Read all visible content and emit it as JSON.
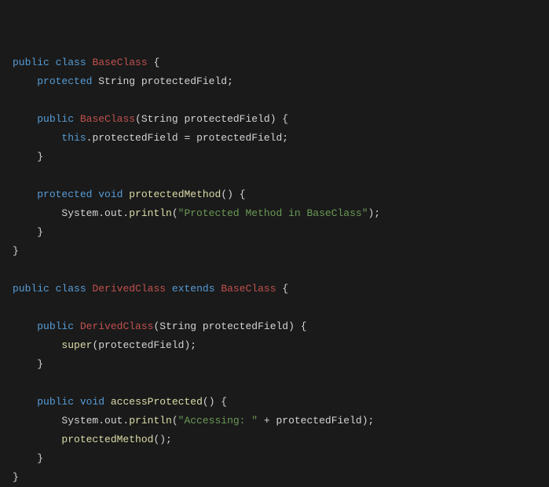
{
  "tokens": [
    {
      "cls": "kw",
      "t": "public"
    },
    {
      "cls": "pln",
      "t": " "
    },
    {
      "cls": "kw",
      "t": "class"
    },
    {
      "cls": "pln",
      "t": " "
    },
    {
      "cls": "cls",
      "t": "BaseClass"
    },
    {
      "cls": "pln",
      "t": " {\n"
    },
    {
      "cls": "pln",
      "t": "    "
    },
    {
      "cls": "kw",
      "t": "protected"
    },
    {
      "cls": "pln",
      "t": " String protectedField;\n"
    },
    {
      "cls": "pln",
      "t": "\n"
    },
    {
      "cls": "pln",
      "t": "    "
    },
    {
      "cls": "kw",
      "t": "public"
    },
    {
      "cls": "pln",
      "t": " "
    },
    {
      "cls": "cls",
      "t": "BaseClass"
    },
    {
      "cls": "pln",
      "t": "(String protectedField) {\n"
    },
    {
      "cls": "pln",
      "t": "        "
    },
    {
      "cls": "self",
      "t": "this"
    },
    {
      "cls": "pln",
      "t": ".protectedField = protectedField;\n"
    },
    {
      "cls": "pln",
      "t": "    }\n"
    },
    {
      "cls": "pln",
      "t": "\n"
    },
    {
      "cls": "pln",
      "t": "    "
    },
    {
      "cls": "kw",
      "t": "protected"
    },
    {
      "cls": "pln",
      "t": " "
    },
    {
      "cls": "kw",
      "t": "void"
    },
    {
      "cls": "pln",
      "t": " "
    },
    {
      "cls": "fn",
      "t": "protectedMethod"
    },
    {
      "cls": "pln",
      "t": "() {\n"
    },
    {
      "cls": "pln",
      "t": "        System.out."
    },
    {
      "cls": "fn",
      "t": "println"
    },
    {
      "cls": "pln",
      "t": "("
    },
    {
      "cls": "str",
      "t": "\"Protected Method in BaseClass\""
    },
    {
      "cls": "pln",
      "t": ");\n"
    },
    {
      "cls": "pln",
      "t": "    }\n"
    },
    {
      "cls": "pln",
      "t": "}\n"
    },
    {
      "cls": "pln",
      "t": "\n"
    },
    {
      "cls": "kw",
      "t": "public"
    },
    {
      "cls": "pln",
      "t": " "
    },
    {
      "cls": "kw",
      "t": "class"
    },
    {
      "cls": "pln",
      "t": " "
    },
    {
      "cls": "cls",
      "t": "DerivedClass"
    },
    {
      "cls": "pln",
      "t": " "
    },
    {
      "cls": "kw",
      "t": "extends"
    },
    {
      "cls": "pln",
      "t": " "
    },
    {
      "cls": "cls",
      "t": "BaseClass"
    },
    {
      "cls": "pln",
      "t": " {\n"
    },
    {
      "cls": "pln",
      "t": "\n"
    },
    {
      "cls": "pln",
      "t": "    "
    },
    {
      "cls": "kw",
      "t": "public"
    },
    {
      "cls": "pln",
      "t": " "
    },
    {
      "cls": "cls",
      "t": "DerivedClass"
    },
    {
      "cls": "pln",
      "t": "(String protectedField) {\n"
    },
    {
      "cls": "pln",
      "t": "        "
    },
    {
      "cls": "fn",
      "t": "super"
    },
    {
      "cls": "pln",
      "t": "(protectedField);\n"
    },
    {
      "cls": "pln",
      "t": "    }\n"
    },
    {
      "cls": "pln",
      "t": "\n"
    },
    {
      "cls": "pln",
      "t": "    "
    },
    {
      "cls": "kw",
      "t": "public"
    },
    {
      "cls": "pln",
      "t": " "
    },
    {
      "cls": "kw",
      "t": "void"
    },
    {
      "cls": "pln",
      "t": " "
    },
    {
      "cls": "fn",
      "t": "accessProtected"
    },
    {
      "cls": "pln",
      "t": "() {\n"
    },
    {
      "cls": "pln",
      "t": "        System.out."
    },
    {
      "cls": "fn",
      "t": "println"
    },
    {
      "cls": "pln",
      "t": "("
    },
    {
      "cls": "str",
      "t": "\"Accessing: \""
    },
    {
      "cls": "pln",
      "t": " + protectedField);\n"
    },
    {
      "cls": "pln",
      "t": "        "
    },
    {
      "cls": "fn",
      "t": "protectedMethod"
    },
    {
      "cls": "pln",
      "t": "();\n"
    },
    {
      "cls": "pln",
      "t": "    }\n"
    },
    {
      "cls": "pln",
      "t": "}\n"
    }
  ]
}
